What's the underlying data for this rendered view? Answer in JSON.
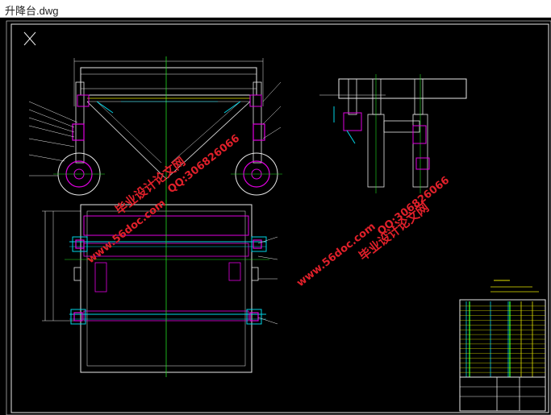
{
  "window": {
    "title": "升降台.dwg"
  },
  "colors": {
    "canvas_bg": "#000000",
    "border": "#ffffff",
    "line_white": "#e8e8e8",
    "line_yellow": "#e5e500",
    "line_cyan": "#00d4e6",
    "line_magenta": "#e000e0",
    "line_green": "#22dd22",
    "watermark_red": "#e0202a"
  },
  "watermark": {
    "site": "www.56doc.com",
    "brand": "毕业设计论文网",
    "qq": "QQ:306826066"
  },
  "drawing": {
    "title_block_rows": 16
  }
}
